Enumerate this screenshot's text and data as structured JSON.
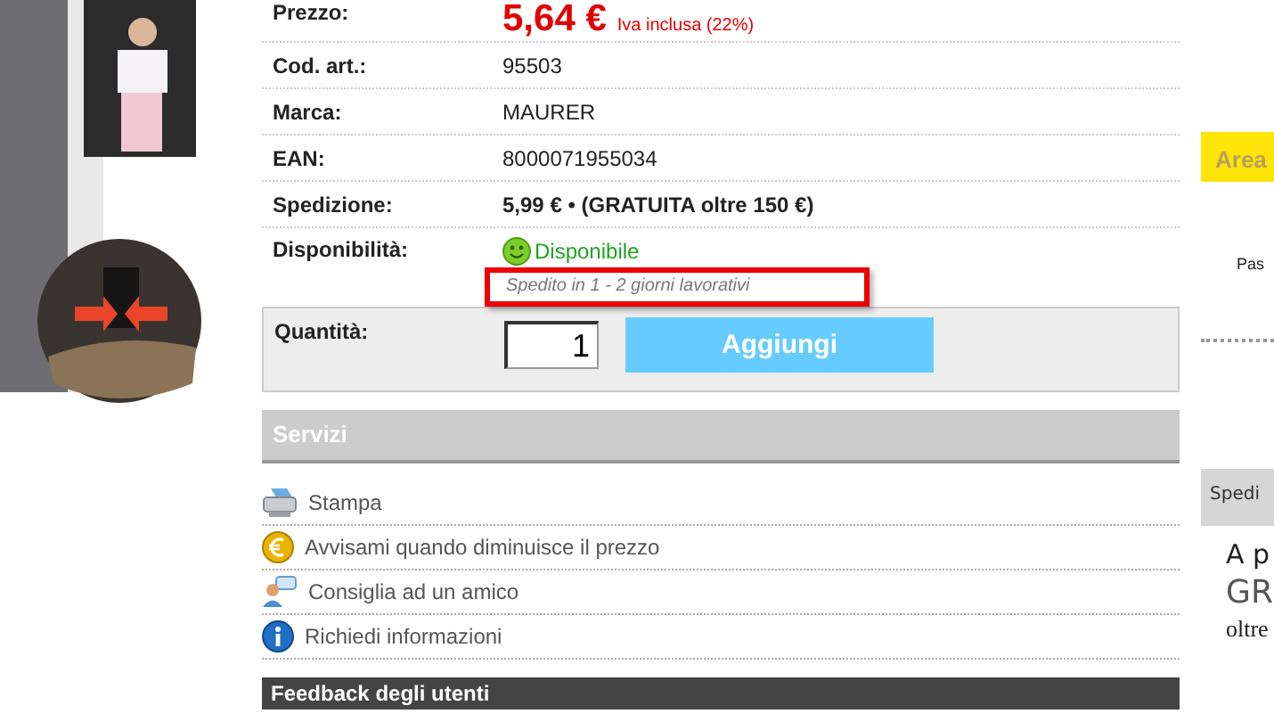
{
  "details": [
    {
      "label": "Prezzo:",
      "kind": "price",
      "value": "5,64 €",
      "note": "Iva inclusa (22%)"
    },
    {
      "label": "Cod. art.:",
      "kind": "plain",
      "value": "95503"
    },
    {
      "label": "Marca:",
      "kind": "plain",
      "value": "MAURER"
    },
    {
      "label": "EAN:",
      "kind": "plain",
      "value": "8000071955034"
    },
    {
      "label": "Spedizione:",
      "kind": "bold",
      "value": "5,99 € • (GRATUITA oltre 150 €)"
    },
    {
      "label": "Disponibilità:",
      "kind": "availability",
      "value": "Disponibile",
      "note": "Spedito in 1 - 2 giorni lavorativi"
    }
  ],
  "quantity": {
    "label": "Quantità:",
    "value": "1",
    "button": "Aggiungi"
  },
  "services": {
    "title": "Servizi",
    "items": [
      {
        "label": "Stampa",
        "kind": "print"
      },
      {
        "label": "Avvisami quando diminuisce il prezzo",
        "kind": "euro"
      },
      {
        "label": "Consiglia ad un amico",
        "kind": "friend"
      },
      {
        "label": "Richiedi informazioni",
        "kind": "info"
      }
    ]
  },
  "feedback": {
    "title": "Feedback degli utenti"
  },
  "sidebar": {
    "area_title": "Area",
    "area_text": "Pas",
    "shipping_title": "Spedi",
    "promo_lines": [
      "A p",
      "GR"
    ],
    "promo_small": "oltre"
  }
}
